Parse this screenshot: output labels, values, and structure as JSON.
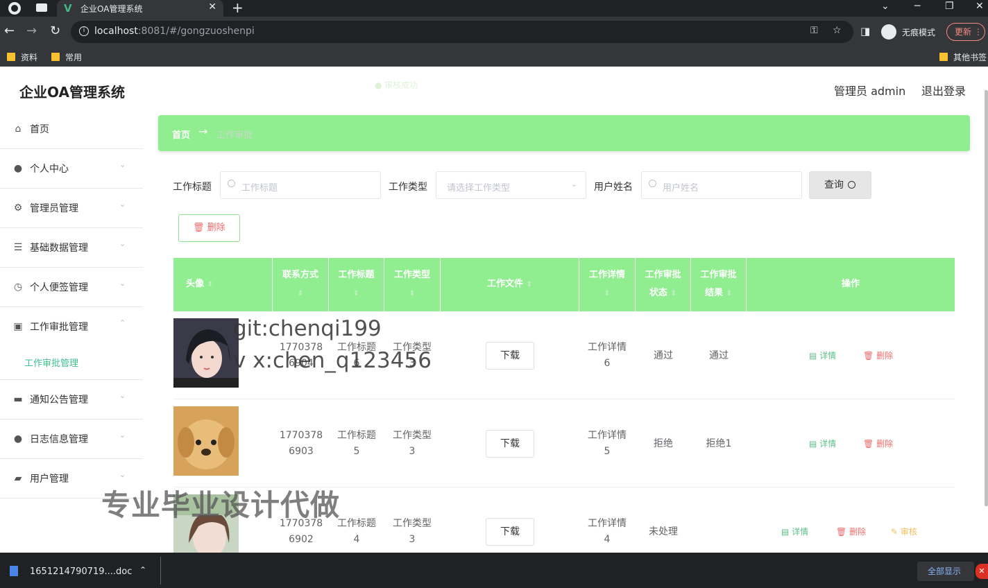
{
  "browser": {
    "tab_title": "企业OA管理系统",
    "tab_logo": "V",
    "url_host": "localhost",
    "url_rest": ":8081/#/gongzuoshenpi",
    "incognito_label": "无痕模式",
    "update_label": "更新",
    "bookmarks": [
      "资料",
      "常用",
      "其他书签"
    ]
  },
  "header": {
    "app_title": "企业OA管理系统",
    "toast": "审核成功",
    "user_label": "管理员 admin",
    "logout_label": "退出登录"
  },
  "sidebar": {
    "items": [
      {
        "label": "首页",
        "icon": "home-icon"
      },
      {
        "label": "个人中心",
        "icon": "user-icon"
      },
      {
        "label": "管理员管理",
        "icon": "gear-icon"
      },
      {
        "label": "基础数据管理",
        "icon": "layers-icon"
      },
      {
        "label": "个人便签管理",
        "icon": "clock-icon"
      },
      {
        "label": "工作审批管理",
        "icon": "document-icon"
      },
      {
        "label": "通知公告管理",
        "icon": "keyboard-icon"
      },
      {
        "label": "日志信息管理",
        "icon": "user-icon"
      },
      {
        "label": "用户管理",
        "icon": "folder-icon"
      }
    ],
    "submenu_label": "工作审批管理"
  },
  "breadcrumb": {
    "home": "首页",
    "separator": "→",
    "current": "工作审批"
  },
  "search": {
    "title_label": "工作标题",
    "title_placeholder": "工作标题",
    "type_label": "工作类型",
    "type_placeholder": "请选择工作类型",
    "username_label": "用户姓名",
    "username_placeholder": "用户姓名",
    "query_label": "查询",
    "delete_label": "删除"
  },
  "table": {
    "headers": {
      "avatar": "头像",
      "contact": "联系方式",
      "title": "工作标题",
      "type": "工作类型",
      "file": "工作文件",
      "detail": "工作详情",
      "status_a": "工作审批",
      "status_b": "状态",
      "result_a": "工作审批",
      "result_b": "结果",
      "actions": "操作"
    },
    "rows": [
      {
        "contact_a": "1770378",
        "contact_b": "6904",
        "title_a": "工作标题",
        "title_b": "6",
        "type_a": "工作类型",
        "type_b": "3",
        "download": "下载",
        "detail_a": "工作详情",
        "detail_b": "6",
        "status": "通过",
        "result": "通过",
        "detail_action": "详情",
        "delete_action": "删除"
      },
      {
        "contact_a": "1770378",
        "contact_b": "6903",
        "title_a": "工作标题",
        "title_b": "5",
        "type_a": "工作类型",
        "type_b": "3",
        "download": "下载",
        "detail_a": "工作详情",
        "detail_b": "5",
        "status": "拒绝",
        "result": "拒绝1",
        "detail_action": "详情",
        "delete_action": "删除"
      },
      {
        "contact_a": "1770378",
        "contact_b": "6902",
        "title_a": "工作标题",
        "title_b": "4",
        "type_a": "工作类型",
        "type_b": "3",
        "download": "下载",
        "detail_a": "工作详情",
        "detail_b": "4",
        "status": "未处理",
        "result": "",
        "detail_action": "详情",
        "delete_action": "删除",
        "audit_action": "审核"
      }
    ]
  },
  "overlay": {
    "git_text": "git:chenqi199",
    "wx_text": "v x:chen_q123456",
    "ad_text": "专业毕业设计代做"
  },
  "download_shelf": {
    "file_name": "1651214790719....doc",
    "show_all": "全部显示"
  },
  "colors": {
    "accent_green": "#90ee90",
    "danger": "#f56c6c",
    "success_text": "#3fbf8f",
    "warning": "#f5c05a"
  }
}
